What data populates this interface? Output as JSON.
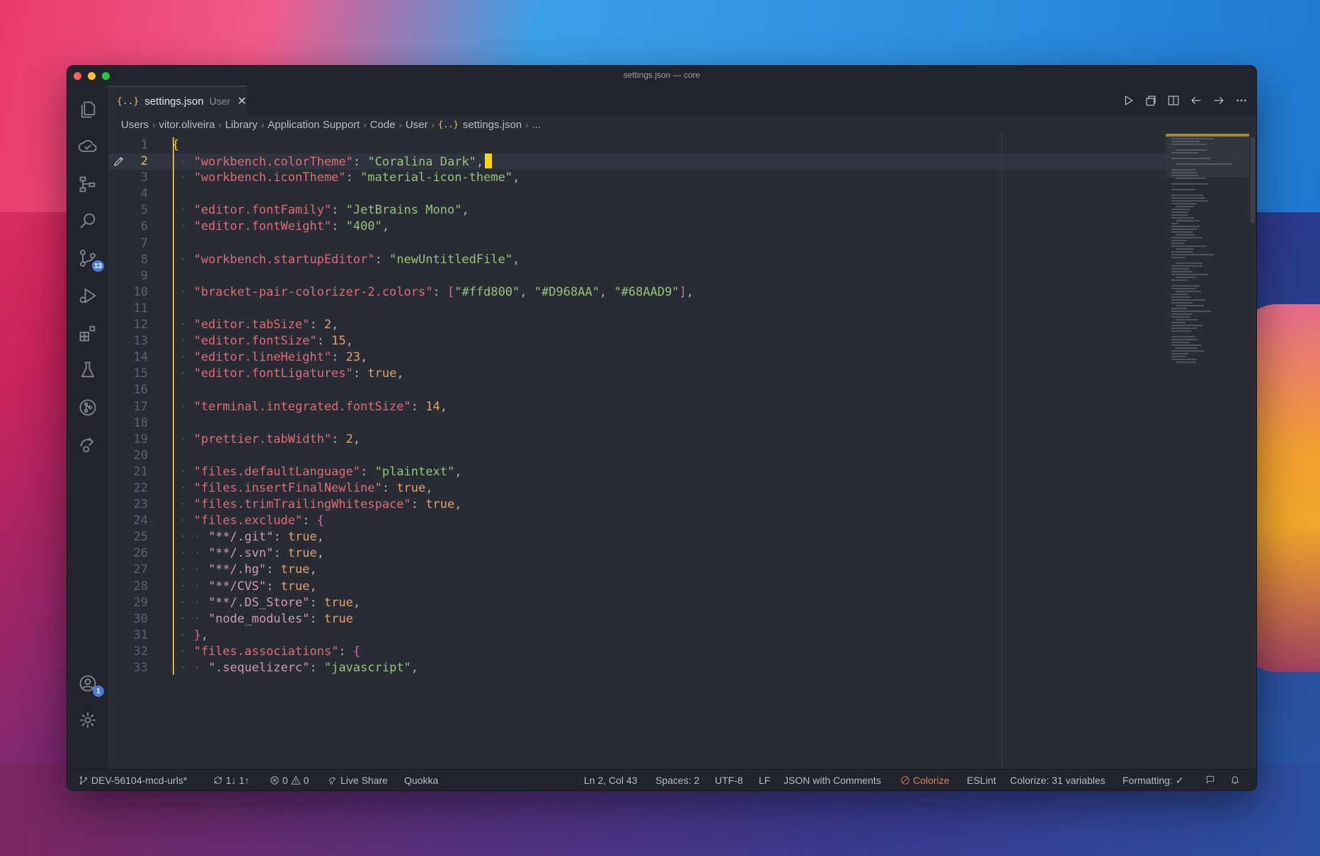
{
  "window": {
    "title": "settings.json — core"
  },
  "activity_bar": {
    "items": [
      {
        "name": "explorer-icon"
      },
      {
        "name": "remote-icon"
      },
      {
        "name": "workflow-icon"
      },
      {
        "name": "search-icon"
      },
      {
        "name": "source-control-icon",
        "badge": "13"
      },
      {
        "name": "run-debug-icon"
      },
      {
        "name": "extensions-icon"
      },
      {
        "name": "testing-icon"
      },
      {
        "name": "git-graph-icon"
      },
      {
        "name": "live-share-icon"
      },
      {
        "name": "accounts-icon",
        "badge": "1"
      },
      {
        "name": "settings-gear-icon"
      }
    ]
  },
  "tab": {
    "icon": "{..}",
    "label": "settings.json",
    "description": "User",
    "close": "✕"
  },
  "tab_actions": [
    "run-icon",
    "open-changes-icon",
    "split-editor-icon",
    "go-back-icon",
    "go-forward-icon",
    "more-actions-icon"
  ],
  "breadcrumb": {
    "items": [
      "Users",
      "vitor.oliveira",
      "Library",
      "Application Support",
      "Code",
      "User"
    ],
    "file_icon": "{..}",
    "file": "settings.json",
    "trailing": "..."
  },
  "editor": {
    "active_line": 2,
    "lines": [
      {
        "n": "1",
        "tokens": [
          [
            "br1",
            "{"
          ]
        ]
      },
      {
        "n": "2",
        "tokens": [
          [
            "k",
            "\"workbench.colorTheme\""
          ],
          [
            "p",
            ": "
          ],
          [
            "s",
            "\"Coralina Dark\""
          ],
          [
            "p",
            ","
          ]
        ],
        "cursor": true
      },
      {
        "n": "3",
        "tokens": [
          [
            "k",
            "\"workbench.iconTheme\""
          ],
          [
            "p",
            ": "
          ],
          [
            "s",
            "\"material-icon-theme\""
          ],
          [
            "p",
            ","
          ]
        ]
      },
      {
        "n": "4",
        "tokens": []
      },
      {
        "n": "5",
        "tokens": [
          [
            "k",
            "\"editor.fontFamily\""
          ],
          [
            "p",
            ": "
          ],
          [
            "s",
            "\"JetBrains Mono\""
          ],
          [
            "p",
            ","
          ]
        ]
      },
      {
        "n": "6",
        "tokens": [
          [
            "k",
            "\"editor.fontWeight\""
          ],
          [
            "p",
            ": "
          ],
          [
            "s",
            "\"400\""
          ],
          [
            "p",
            ","
          ]
        ]
      },
      {
        "n": "7",
        "tokens": []
      },
      {
        "n": "8",
        "tokens": [
          [
            "k",
            "\"workbench.startupEditor\""
          ],
          [
            "p",
            ": "
          ],
          [
            "s",
            "\"newUntitledFile\""
          ],
          [
            "p",
            ","
          ]
        ]
      },
      {
        "n": "9",
        "tokens": []
      },
      {
        "n": "10",
        "tokens": [
          [
            "k",
            "\"bracket-pair-colorizer-2.colors\""
          ],
          [
            "p",
            ": "
          ],
          [
            "br2",
            "["
          ],
          [
            "s",
            "\"#ffd800\""
          ],
          [
            "p",
            ", "
          ],
          [
            "s",
            "\"#D968AA\""
          ],
          [
            "p",
            ", "
          ],
          [
            "s",
            "\"#68AAD9\""
          ],
          [
            "br2",
            "]"
          ],
          [
            "p",
            ","
          ]
        ]
      },
      {
        "n": "11",
        "tokens": []
      },
      {
        "n": "12",
        "tokens": [
          [
            "k",
            "\"editor.tabSize\""
          ],
          [
            "p",
            ": "
          ],
          [
            "n",
            "2"
          ],
          [
            "p",
            ","
          ]
        ]
      },
      {
        "n": "13",
        "tokens": [
          [
            "k",
            "\"editor.fontSize\""
          ],
          [
            "p",
            ": "
          ],
          [
            "n",
            "15"
          ],
          [
            "p",
            ","
          ]
        ]
      },
      {
        "n": "14",
        "tokens": [
          [
            "k",
            "\"editor.lineHeight\""
          ],
          [
            "p",
            ": "
          ],
          [
            "n",
            "23"
          ],
          [
            "p",
            ","
          ]
        ]
      },
      {
        "n": "15",
        "tokens": [
          [
            "k",
            "\"editor.fontLigatures\""
          ],
          [
            "p",
            ": "
          ],
          [
            "b",
            "true"
          ],
          [
            "p",
            ","
          ]
        ]
      },
      {
        "n": "16",
        "tokens": []
      },
      {
        "n": "17",
        "tokens": [
          [
            "k",
            "\"terminal.integrated.fontSize\""
          ],
          [
            "p",
            ": "
          ],
          [
            "n",
            "14"
          ],
          [
            "p",
            ","
          ]
        ]
      },
      {
        "n": "18",
        "tokens": []
      },
      {
        "n": "19",
        "tokens": [
          [
            "k",
            "\"prettier.tabWidth\""
          ],
          [
            "p",
            ": "
          ],
          [
            "n",
            "2"
          ],
          [
            "p",
            ","
          ]
        ]
      },
      {
        "n": "20",
        "tokens": []
      },
      {
        "n": "21",
        "tokens": [
          [
            "k",
            "\"files.defaultLanguage\""
          ],
          [
            "p",
            ": "
          ],
          [
            "s",
            "\"plaintext\""
          ],
          [
            "p",
            ","
          ]
        ]
      },
      {
        "n": "22",
        "tokens": [
          [
            "k",
            "\"files.insertFinalNewline\""
          ],
          [
            "p",
            ": "
          ],
          [
            "b",
            "true"
          ],
          [
            "p",
            ","
          ]
        ]
      },
      {
        "n": "23",
        "tokens": [
          [
            "k",
            "\"files.trimTrailingWhitespace\""
          ],
          [
            "p",
            ": "
          ],
          [
            "b",
            "true"
          ],
          [
            "p",
            ","
          ]
        ]
      },
      {
        "n": "24",
        "tokens": [
          [
            "k",
            "\"files.exclude\""
          ],
          [
            "p",
            ": "
          ],
          [
            "br2",
            "{"
          ]
        ]
      },
      {
        "n": "25",
        "indent": 2,
        "tokens": [
          [
            "kp",
            "\"**/.git\""
          ],
          [
            "p",
            ": "
          ],
          [
            "b",
            "true"
          ],
          [
            "p",
            ","
          ]
        ]
      },
      {
        "n": "26",
        "indent": 2,
        "tokens": [
          [
            "kp",
            "\"**/.svn\""
          ],
          [
            "p",
            ": "
          ],
          [
            "b",
            "true"
          ],
          [
            "p",
            ","
          ]
        ]
      },
      {
        "n": "27",
        "indent": 2,
        "tokens": [
          [
            "kp",
            "\"**/.hg\""
          ],
          [
            "p",
            ": "
          ],
          [
            "b",
            "true"
          ],
          [
            "p",
            ","
          ]
        ]
      },
      {
        "n": "28",
        "indent": 2,
        "tokens": [
          [
            "kp",
            "\"**/CVS\""
          ],
          [
            "p",
            ": "
          ],
          [
            "b",
            "true"
          ],
          [
            "p",
            ","
          ]
        ]
      },
      {
        "n": "29",
        "indent": 2,
        "tokens": [
          [
            "kp",
            "\"**/.DS_Store\""
          ],
          [
            "p",
            ": "
          ],
          [
            "b",
            "true"
          ],
          [
            "p",
            ","
          ]
        ]
      },
      {
        "n": "30",
        "indent": 2,
        "tokens": [
          [
            "kp",
            "\"node_modules\""
          ],
          [
            "p",
            ": "
          ],
          [
            "b",
            "true"
          ]
        ]
      },
      {
        "n": "31",
        "tokens": [
          [
            "br2",
            "}"
          ],
          [
            "p",
            ","
          ]
        ]
      },
      {
        "n": "32",
        "tokens": [
          [
            "k",
            "\"files.associations\""
          ],
          [
            "p",
            ": "
          ],
          [
            "br2",
            "{"
          ]
        ]
      },
      {
        "n": "33",
        "indent": 2,
        "tokens": [
          [
            "kp",
            "\".sequelizerc\""
          ],
          [
            "p",
            ": "
          ],
          [
            "s",
            "\"javascript\""
          ],
          [
            "p",
            ","
          ]
        ]
      }
    ]
  },
  "statusbar": {
    "branch": "DEV-56104-mcd-urls*",
    "sync": "1↓ 1↑",
    "errors": "0",
    "warnings": "0",
    "live_share": "Live Share",
    "quokka": "Quokka",
    "position": "Ln 2, Col 43",
    "spaces": "Spaces: 2",
    "encoding": "UTF-8",
    "eol": "LF",
    "language": "JSON with Comments",
    "colorize": "Colorize",
    "eslint": "ESLint",
    "colorize_vars": "Colorize: 31 variables",
    "formatting": "Formatting: ✓"
  },
  "colors": {
    "accent_yellow": "#ffd800",
    "accent_pink": "#d968aa",
    "accent_blue": "#68aad9",
    "editor_bg": "#282c34",
    "badge": "#4e7ad8"
  }
}
